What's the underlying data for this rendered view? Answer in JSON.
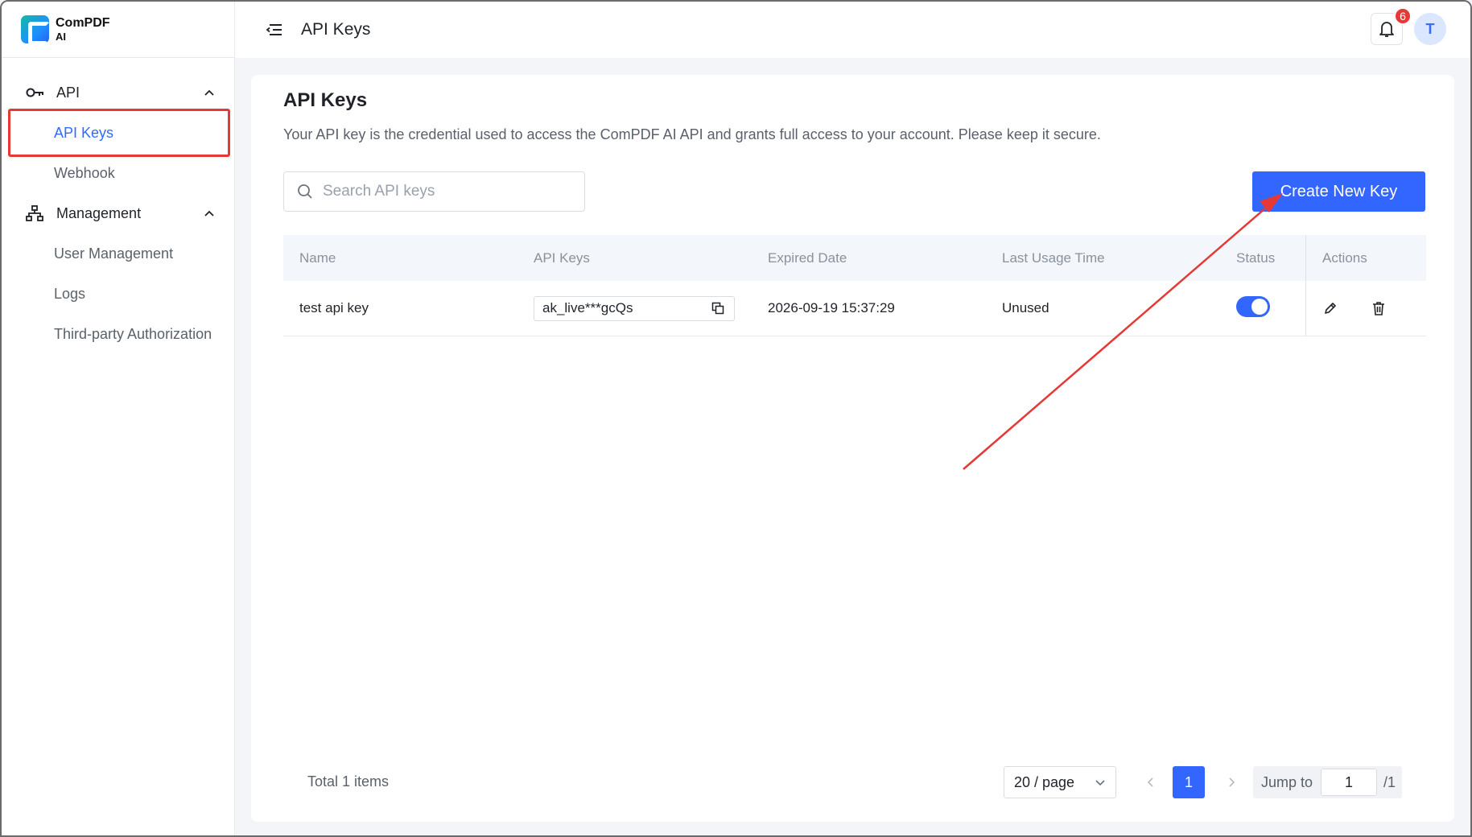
{
  "brand": {
    "line1": "ComPDF",
    "line2": "AI"
  },
  "sidebar": {
    "groups": [
      {
        "label": "API",
        "items": [
          {
            "label": "API Keys"
          },
          {
            "label": "Webhook"
          }
        ]
      },
      {
        "label": "Management",
        "items": [
          {
            "label": "User Management"
          },
          {
            "label": "Logs"
          },
          {
            "label": "Third-party Authorization"
          }
        ]
      }
    ]
  },
  "topbar": {
    "title": "API Keys",
    "notification_count": "6",
    "avatar_initial": "T"
  },
  "page": {
    "title": "API Keys",
    "description": "Your API key is the credential used to access the ComPDF AI API and grants full access to your account. Please keep it secure.",
    "search_placeholder": "Search API keys",
    "create_button": "Create New Key"
  },
  "table": {
    "columns": [
      "Name",
      "API Keys",
      "Expired Date",
      "Last Usage Time",
      "Status",
      "Actions"
    ],
    "rows": [
      {
        "name": "test api key",
        "key": "ak_live***gcQs",
        "expired": "2026-09-19 15:37:29",
        "last_usage": "Unused",
        "status": "on"
      }
    ]
  },
  "pagination": {
    "total": "Total 1 items",
    "page_size": "20 / page",
    "current": "1",
    "jump_label": "Jump to",
    "jump_value": "1",
    "of_total": "/1"
  },
  "colors": {
    "primary": "#3366ff",
    "highlight": "#e53935",
    "annotation_arrow": "#e53935"
  }
}
